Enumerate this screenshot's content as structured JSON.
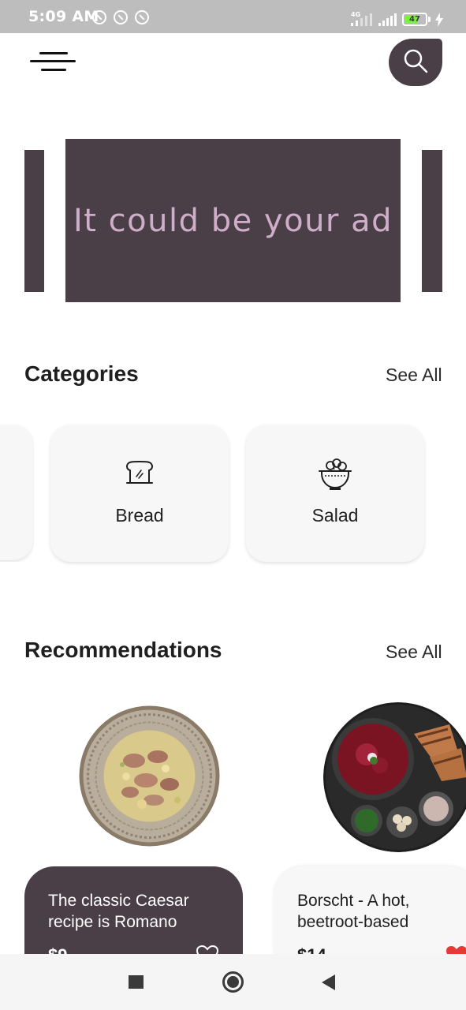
{
  "status_bar": {
    "time": "5:09 AM",
    "network_label": "4G",
    "battery": "47",
    "icons": [
      "alarm-icon",
      "sync-icon",
      "sync-icon",
      "signal-icon",
      "signal-icon",
      "battery-icon",
      "charging-icon"
    ]
  },
  "header": {
    "menu_icon": "menu-icon",
    "search_icon": "search-icon"
  },
  "banner": {
    "text": "It could be your ad"
  },
  "categories": {
    "title": "Categories",
    "see_all": "See All",
    "items": [
      {
        "label": "Bread",
        "icon": "bread-icon"
      },
      {
        "label": "Salad",
        "icon": "salad-icon"
      }
    ]
  },
  "recommendations": {
    "title": "Recommendations",
    "see_all": "See All",
    "items": [
      {
        "title": "The classic Caesar recipe is Romano",
        "price": "$9",
        "favorite": false
      },
      {
        "title": "Borscht - A hot, beetroot-based",
        "price": "$14",
        "favorite": true
      }
    ]
  },
  "colors": {
    "accent": "#4b3f47",
    "banner_text": "#cfaeca",
    "card_bg": "#f7f7f7",
    "favorite": "#e53935"
  },
  "nav": {
    "icons": [
      "recents-icon",
      "home-icon",
      "back-icon"
    ]
  }
}
